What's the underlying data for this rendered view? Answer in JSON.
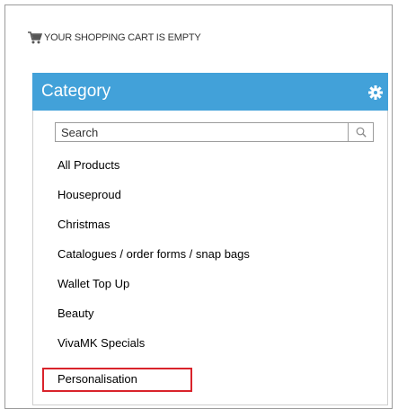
{
  "cart": {
    "icon": "cart-icon",
    "text": "YOUR SHOPPING CART IS EMPTY"
  },
  "category_panel": {
    "title": "Category",
    "settings_icon": "gear-icon",
    "header_color": "#42a1d9",
    "search": {
      "placeholder": "Search",
      "value": "",
      "button_icon": "search-icon"
    },
    "items": [
      {
        "label": "All Products"
      },
      {
        "label": "Houseproud"
      },
      {
        "label": "Christmas"
      },
      {
        "label": "Catalogues / order forms / snap bags"
      },
      {
        "label": "Wallet Top Up"
      },
      {
        "label": "Beauty"
      },
      {
        "label": "VivaMK Specials"
      },
      {
        "label": "Personalisation",
        "highlighted": true
      }
    ],
    "highlight_color": "#d9232b"
  }
}
